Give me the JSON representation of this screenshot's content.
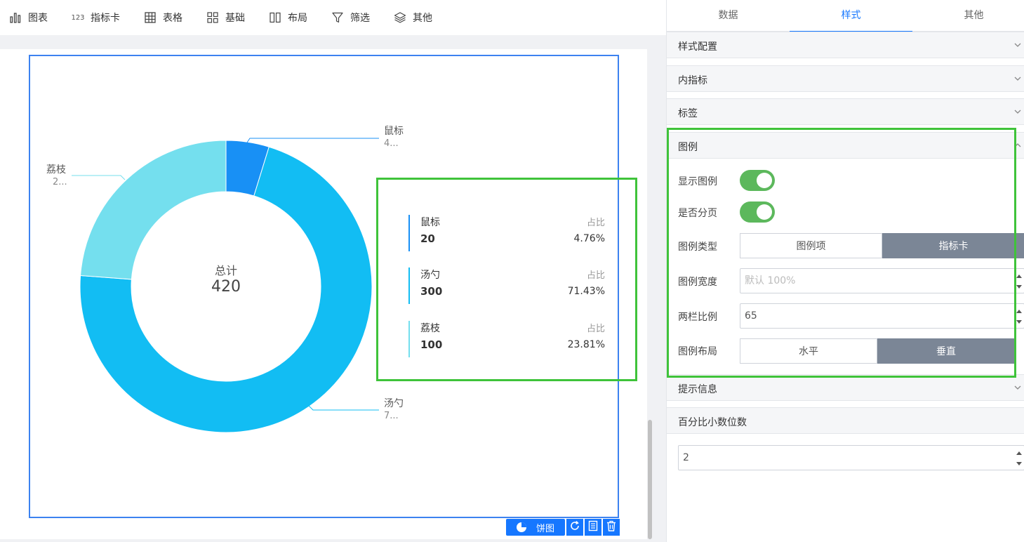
{
  "toolbar": {
    "items": [
      {
        "label": "图表",
        "icon": "bar-chart-icon"
      },
      {
        "label": "指标卡",
        "icon": "number-123-icon",
        "icon_text": "123"
      },
      {
        "label": "表格",
        "icon": "table-grid-icon"
      },
      {
        "label": "基础",
        "icon": "apps-grid-icon"
      },
      {
        "label": "布局",
        "icon": "columns-layout-icon"
      },
      {
        "label": "筛选",
        "icon": "funnel-filter-icon"
      },
      {
        "label": "其他",
        "icon": "layers-icon"
      }
    ]
  },
  "chart_data": {
    "type": "pie",
    "subtype": "donut",
    "center_label": "总计",
    "center_value": "420",
    "categories": [
      "鼠标",
      "汤勺",
      "荔枝"
    ],
    "values": [
      20,
      300,
      100
    ],
    "percentages": [
      "4.76%",
      "71.43%",
      "23.81%"
    ],
    "slice_labels": [
      {
        "name": "鼠标",
        "sub": "4..."
      },
      {
        "name": "汤勺",
        "sub": "7..."
      },
      {
        "name": "荔枝",
        "sub": "2..."
      }
    ],
    "colors": [
      "#1890f5",
      "#12bdf3",
      "#74dfee"
    ],
    "legend": {
      "placement": "right",
      "ratio_label": "占比",
      "items": [
        {
          "name": "鼠标",
          "value": "20",
          "pct": "4.76%",
          "color": "#1890f5"
        },
        {
          "name": "汤勺",
          "value": "300",
          "pct": "71.43%",
          "color": "#12bdf3"
        },
        {
          "name": "荔枝",
          "value": "100",
          "pct": "23.81%",
          "color": "#74dfee"
        }
      ]
    }
  },
  "chart_actions": {
    "type_label": "饼图",
    "icons": [
      "refresh-icon",
      "data-sheet-icon",
      "trash-icon"
    ]
  },
  "panel": {
    "tabs": [
      {
        "label": "数据",
        "active": false
      },
      {
        "label": "样式",
        "active": true
      },
      {
        "label": "其他",
        "active": false
      }
    ],
    "sections": {
      "style_config": "样式配置",
      "inner_indicator": "内指标",
      "labels": "标签",
      "legend": "图例",
      "tooltip": "提示信息",
      "pct_decimals": "百分比小数位数"
    },
    "legend_settings": {
      "show_legend_label": "显示图例",
      "show_legend": true,
      "paginate_label": "是否分页",
      "paginate": true,
      "type_label": "图例类型",
      "type_options": [
        "图例项",
        "指标卡"
      ],
      "type_selected": "指标卡",
      "width_label": "图例宽度",
      "width_placeholder": "默认 100%",
      "ratio_label": "两栏比例",
      "ratio_value": "65",
      "layout_label": "图例布局",
      "layout_options": [
        "水平",
        "垂直"
      ],
      "layout_selected": "垂直"
    },
    "pct_decimals_value": "2"
  },
  "colors": {
    "accent": "#1677ff",
    "highlight_box": "#3fc33a",
    "toggle_on": "#5cb85c",
    "segment_selected": "#7b8696"
  }
}
